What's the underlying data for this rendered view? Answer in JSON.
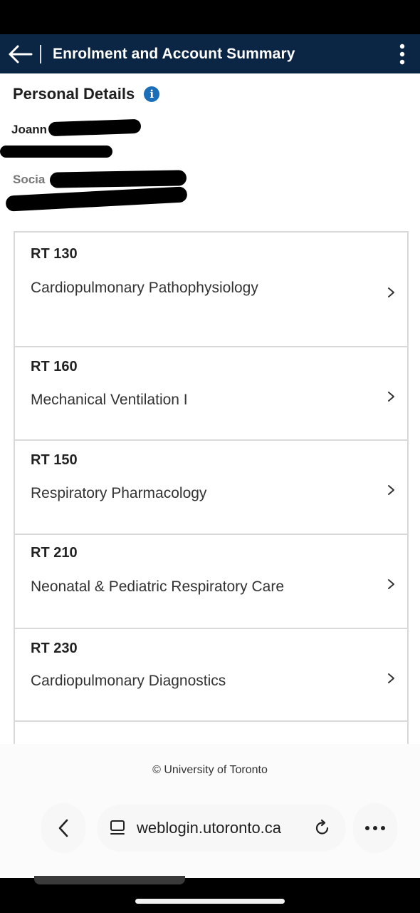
{
  "header": {
    "title": "Enrolment and Account Summary",
    "back_icon": "arrow-left-icon",
    "menu_icon": "kebab-menu-icon",
    "background": "#0b2545"
  },
  "personal": {
    "title": "Personal Details",
    "info_icon": "info-icon",
    "info_glyph": "i",
    "name_visible": "Joann",
    "field_label_visible": "Socia"
  },
  "courses": [
    {
      "code": "RT 130",
      "title": "Cardiopulmonary Pathophysiology"
    },
    {
      "code": "RT 160",
      "title": "Mechanical Ventilation I"
    },
    {
      "code": "RT 150",
      "title": "Respiratory Pharmacology"
    },
    {
      "code": "RT 210",
      "title": "Neonatal & Pediatric Respiratory Care"
    },
    {
      "code": "RT 230",
      "title": "Cardiopulmonary Diagnostics"
    }
  ],
  "footer": {
    "copyright": "© University of Toronto"
  },
  "browser": {
    "url": "weblogin.utoronto.ca",
    "back_icon": "chevron-left-icon",
    "tabs_icon": "page-icon",
    "reload_icon": "reload-icon",
    "more_icon": "more-horizontal-icon"
  }
}
